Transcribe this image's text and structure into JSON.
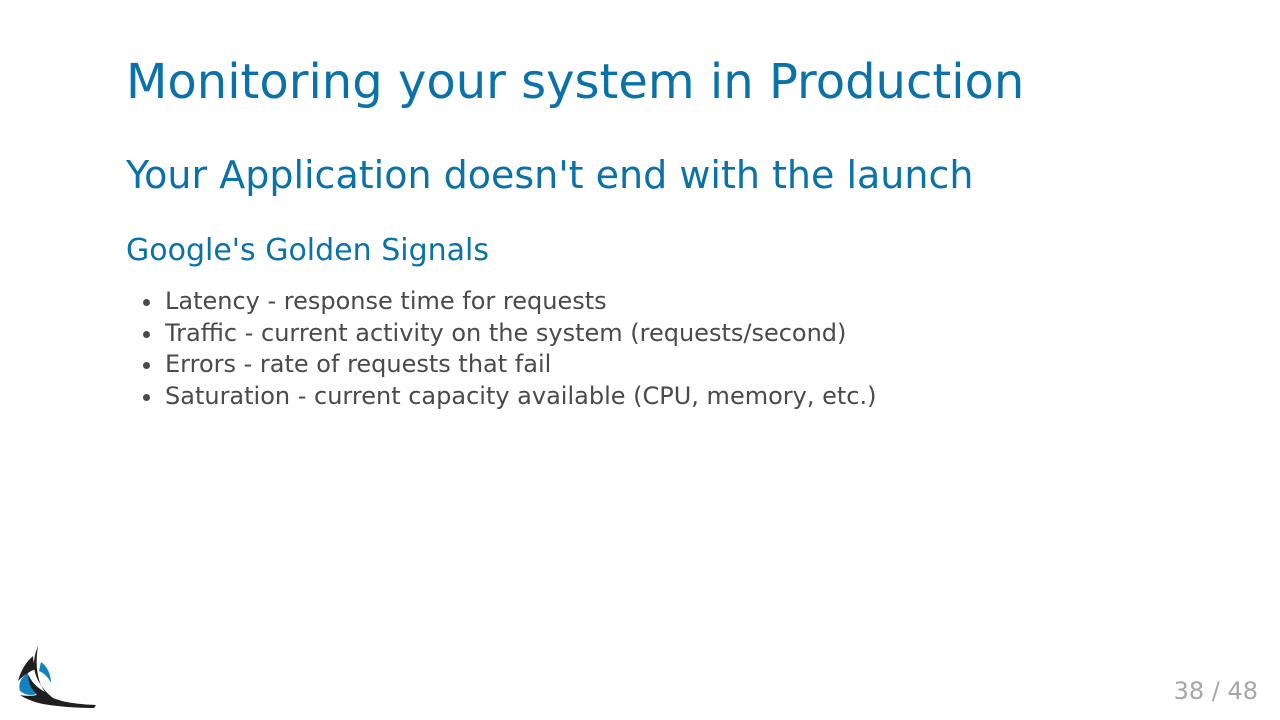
{
  "slide": {
    "title": "Monitoring your system in Production",
    "subtitle": "Your Application doesn't end with the launch",
    "section_heading": "Google's Golden Signals",
    "signals": [
      "Latency - response time for requests",
      "Traffic - current activity on the system (requests/second)",
      "Errors - rate of requests that fail",
      "Saturation - current capacity available (CPU, memory, etc.)"
    ]
  },
  "footer": {
    "logo_icon": "bird-logo-icon",
    "page_counter": "38 / 48"
  },
  "colors": {
    "heading": "#0a72a8",
    "body_text": "#4a4a4a",
    "counter": "#a6a6a6",
    "logo_dark": "#1f1f1f",
    "logo_accent": "#1383bd"
  }
}
